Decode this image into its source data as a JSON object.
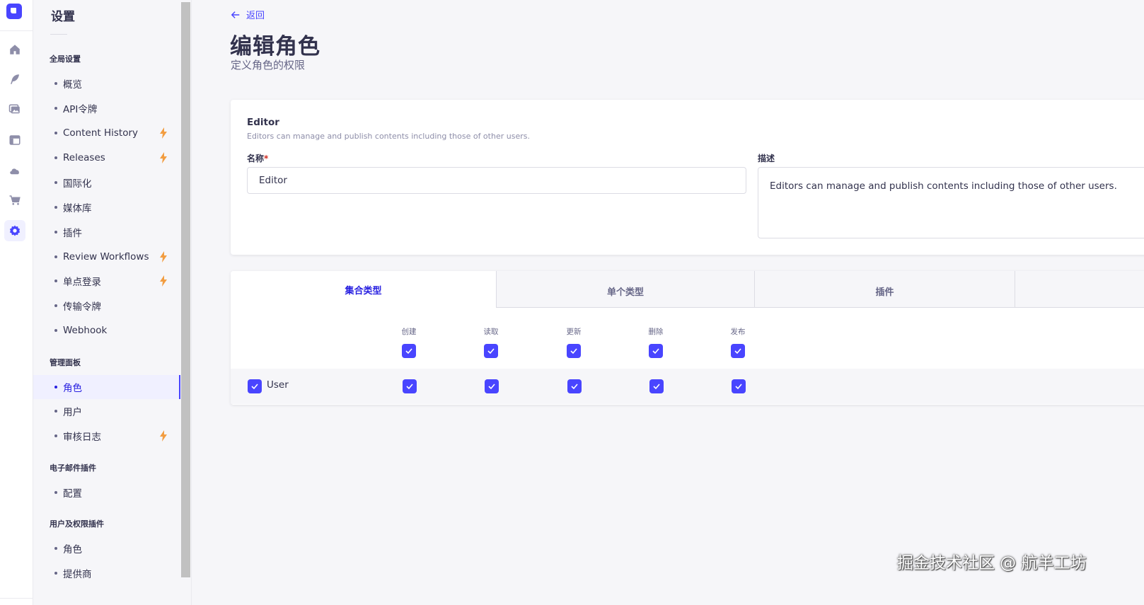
{
  "rail": {
    "icons": [
      "logo-icon",
      "home-icon",
      "content-manager-icon",
      "media-library-icon",
      "content-type-builder-icon",
      "cloud-icon",
      "marketplace-icon",
      "settings-icon"
    ]
  },
  "sidebar": {
    "title": "设置",
    "sections": [
      {
        "title": "全局设置"
      },
      {
        "title": "管理面板"
      },
      {
        "title": "电子邮件插件"
      },
      {
        "title": "用户及权限插件"
      }
    ],
    "items": [
      {
        "label": "概览"
      },
      {
        "label": "API令牌"
      },
      {
        "label": "Content History",
        "premium": true
      },
      {
        "label": "Releases",
        "premium": true
      },
      {
        "label": "国际化"
      },
      {
        "label": "媒体库"
      },
      {
        "label": "插件"
      },
      {
        "label": "Review Workflows",
        "premium": true
      },
      {
        "label": "单点登录",
        "premium": true
      },
      {
        "label": "传输令牌"
      },
      {
        "label": "Webhook"
      },
      {
        "label": "角色",
        "active": true
      },
      {
        "label": "用户"
      },
      {
        "label": "审核日志",
        "premium": true
      },
      {
        "label": "配置"
      },
      {
        "label": "角色"
      },
      {
        "label": "提供商"
      }
    ]
  },
  "header": {
    "back_label": "返回",
    "title": "编辑角色",
    "subtitle": "定义角色的权限"
  },
  "role": {
    "name": "Editor",
    "description": "Editors can manage and publish contents including those of other users.",
    "name_label": "名称",
    "required_mark": "*",
    "description_label": "描述",
    "name_value": "Editor",
    "description_value": "Editors can manage and publish contents including those of other users."
  },
  "permissions": {
    "tabs": [
      {
        "label": "集合类型",
        "active": true
      },
      {
        "label": "单个类型"
      },
      {
        "label": "插件"
      }
    ],
    "columns": [
      "创建",
      "读取",
      "更新",
      "删除",
      "发布"
    ],
    "rows": [
      {
        "label": "User",
        "checked": true
      }
    ]
  },
  "watermark": "掘金技术社区 @ 航羊工坊",
  "colors": {
    "primary": "#4945ff",
    "active_text": "#271fe0",
    "premium_bolt": "#f29d41",
    "background": "#f6f6f9"
  }
}
